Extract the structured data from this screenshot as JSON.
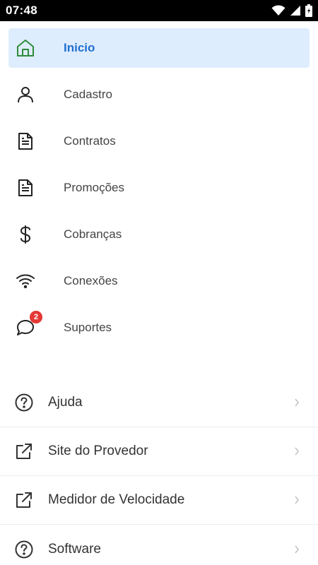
{
  "status_bar": {
    "time": "07:48",
    "icons": [
      "wifi-icon",
      "signal-icon",
      "battery-icon"
    ]
  },
  "colors": {
    "active_bg": "#deedfd",
    "active_text": "#1f6fd0",
    "home_icon": "#2e8b3a",
    "badge": "#e53935"
  },
  "menu": {
    "items": [
      {
        "label": "Inicio",
        "icon": "home-icon",
        "active": true
      },
      {
        "label": "Cadastro",
        "icon": "user-icon"
      },
      {
        "label": "Contratos",
        "icon": "document-icon"
      },
      {
        "label": "Promoções",
        "icon": "document-icon"
      },
      {
        "label": "Cobranças",
        "icon": "dollar-icon"
      },
      {
        "label": "Conexões",
        "icon": "wifi-icon"
      },
      {
        "label": "Suportes",
        "icon": "chat-icon",
        "badge": "2"
      }
    ]
  },
  "links": [
    {
      "label": "Ajuda",
      "icon": "help-circle-icon"
    },
    {
      "label": "Site do Provedor",
      "icon": "external-link-icon"
    },
    {
      "label": "Medidor de Velocidade",
      "icon": "external-link-icon"
    },
    {
      "label": "Software",
      "icon": "help-circle-icon"
    }
  ]
}
